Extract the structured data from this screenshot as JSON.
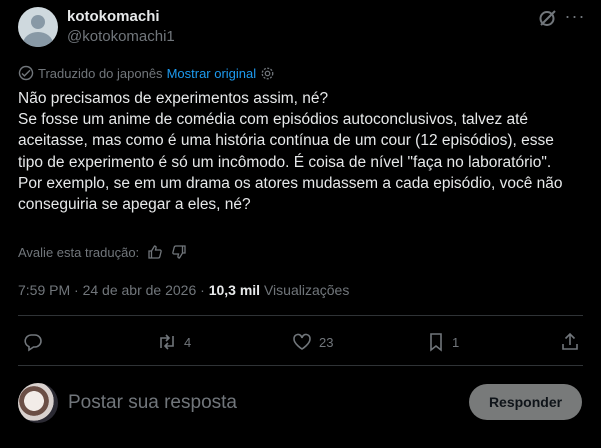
{
  "author": {
    "name": "kotokomachi",
    "handle": "@kotokomachi1"
  },
  "translation": {
    "note": "Traduzido do japonês",
    "show_original": "Mostrar original"
  },
  "post": {
    "text": "Não precisamos de experimentos assim, né?\nSe fosse um anime de comédia com episódios autoconclusivos, talvez até aceitasse, mas como é uma história contínua de um cour (12 episódios), esse tipo de experimento é só um incômodo. É coisa de nível \"faça no laboratório\". Por exemplo, se em um drama os atores mudassem a cada episódio, você não conseguiria se apegar a eles, né?",
    "rate_translation": "Avalie esta tradução:"
  },
  "meta": {
    "time": "7:59 PM",
    "sep1": "·",
    "date": "24 de abr de 2026",
    "sep2": "·",
    "views_count": "10,3 mil",
    "views_label": "Visualizações"
  },
  "actions": {
    "reposts": "4",
    "likes": "23",
    "bookmarks": "1"
  },
  "reply": {
    "placeholder": "Postar sua resposta",
    "button": "Responder"
  },
  "colors": {
    "background": "#000000",
    "text": "#e7e9ea",
    "muted": "#71767b",
    "link": "#1d9bf0",
    "divider": "#2f3336",
    "button_bg": "#787a7a"
  }
}
